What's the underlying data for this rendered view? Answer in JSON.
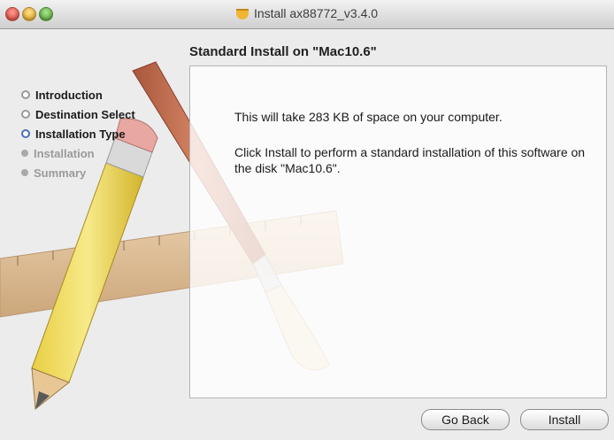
{
  "window": {
    "title": "Install ax88772_v3.4.0"
  },
  "heading": "Standard Install on \"Mac10.6\"",
  "steps": [
    {
      "label": "Introduction",
      "state": "done"
    },
    {
      "label": "Destination Select",
      "state": "done"
    },
    {
      "label": "Installation Type",
      "state": "current"
    },
    {
      "label": "Installation",
      "state": "pending"
    },
    {
      "label": "Summary",
      "state": "pending"
    }
  ],
  "content": {
    "line1": "This will take 283 KB of space on your computer.",
    "line2": "Click Install to perform a standard installation of this software on the disk \"Mac10.6\"."
  },
  "buttons": {
    "back": "Go Back",
    "install": "Install"
  },
  "colors": {
    "active_bullet": "#4b6fb5",
    "accent_package": "#f1b534"
  }
}
